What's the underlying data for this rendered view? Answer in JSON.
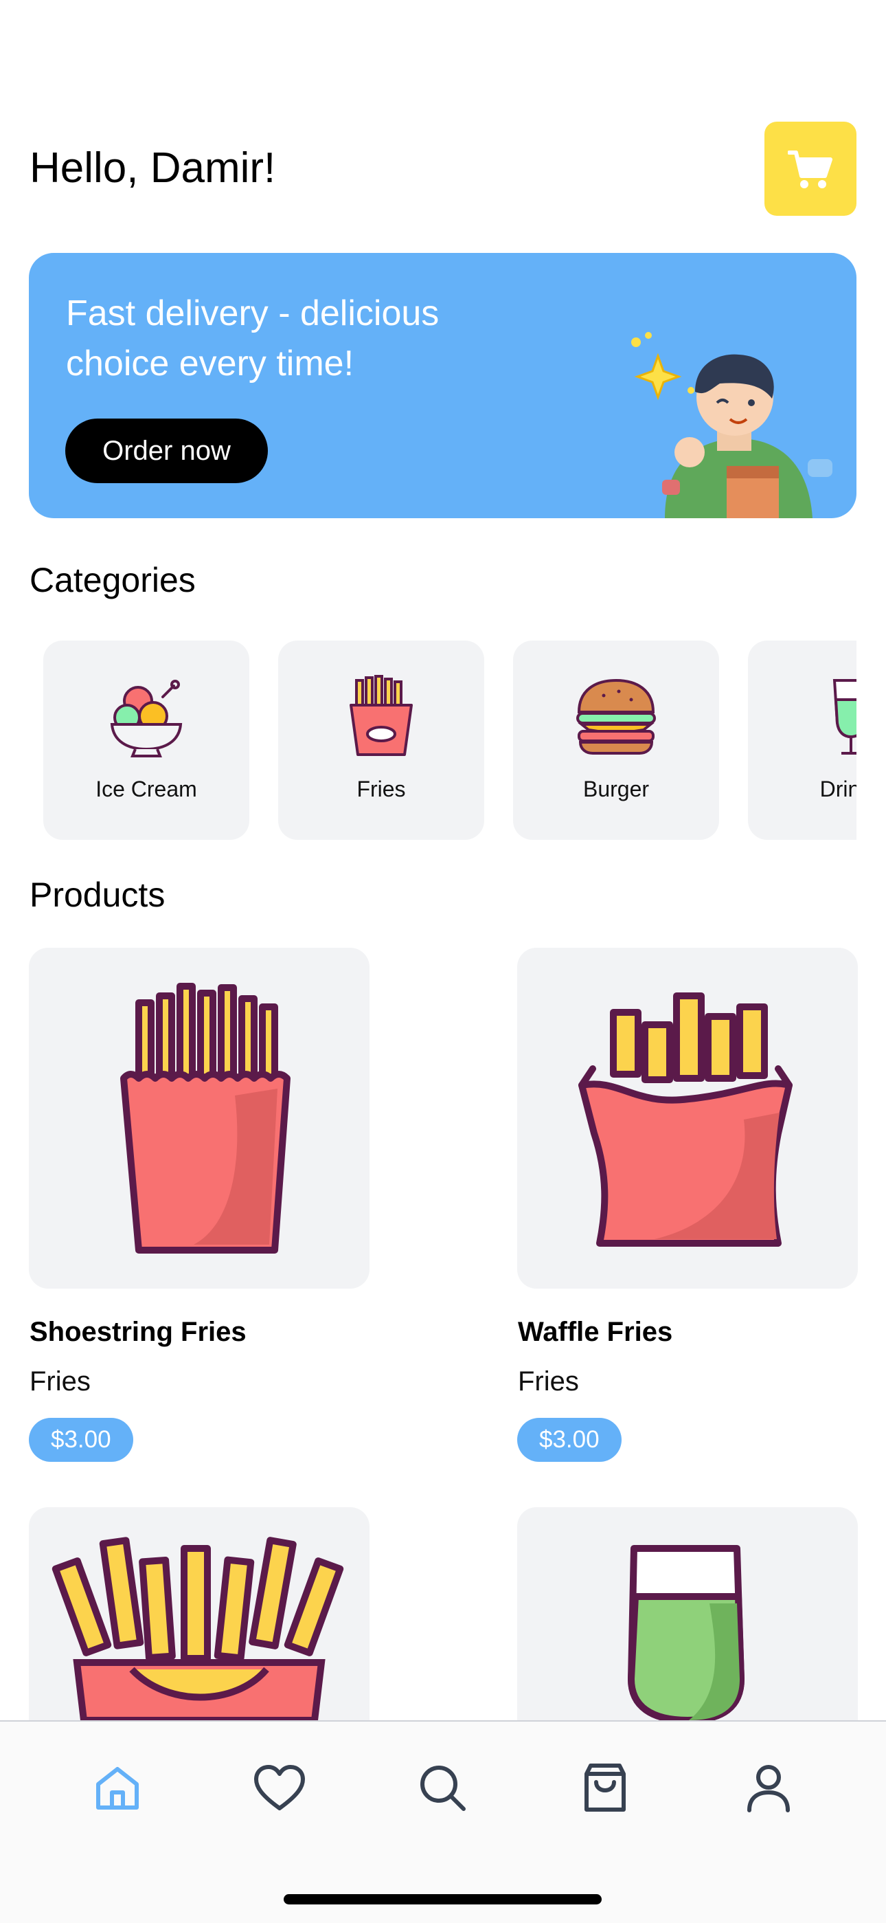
{
  "header": {
    "greeting": "Hello, Damir!",
    "cart_icon": "shopping-cart-icon",
    "cart_color": "#fde047"
  },
  "banner": {
    "title": "Fast delivery - delicious choice every time!",
    "button_label": "Order now",
    "background": "#64b1f8"
  },
  "categories": {
    "title": "Categories",
    "items": [
      {
        "label": "Ice Cream",
        "icon": "ice-cream-icon"
      },
      {
        "label": "Fries",
        "icon": "fries-icon"
      },
      {
        "label": "Burger",
        "icon": "burger-icon"
      },
      {
        "label": "Drinks",
        "icon": "drink-icon"
      }
    ]
  },
  "products": {
    "title": "Products",
    "items": [
      {
        "name": "Shoestring Fries",
        "category": "Fries",
        "price": "$3.00"
      },
      {
        "name": "Waffle Fries",
        "category": "Fries",
        "price": "$3.00"
      },
      {
        "name": "",
        "category": "",
        "price": ""
      },
      {
        "name": "",
        "category": "",
        "price": ""
      }
    ]
  },
  "nav": {
    "items": [
      {
        "icon": "home-icon",
        "active": true
      },
      {
        "icon": "heart-icon",
        "active": false
      },
      {
        "icon": "search-icon",
        "active": false
      },
      {
        "icon": "shopping-bag-icon",
        "active": false
      },
      {
        "icon": "user-icon",
        "active": false
      }
    ],
    "active_color": "#64b1f8",
    "inactive_color": "#374151"
  }
}
